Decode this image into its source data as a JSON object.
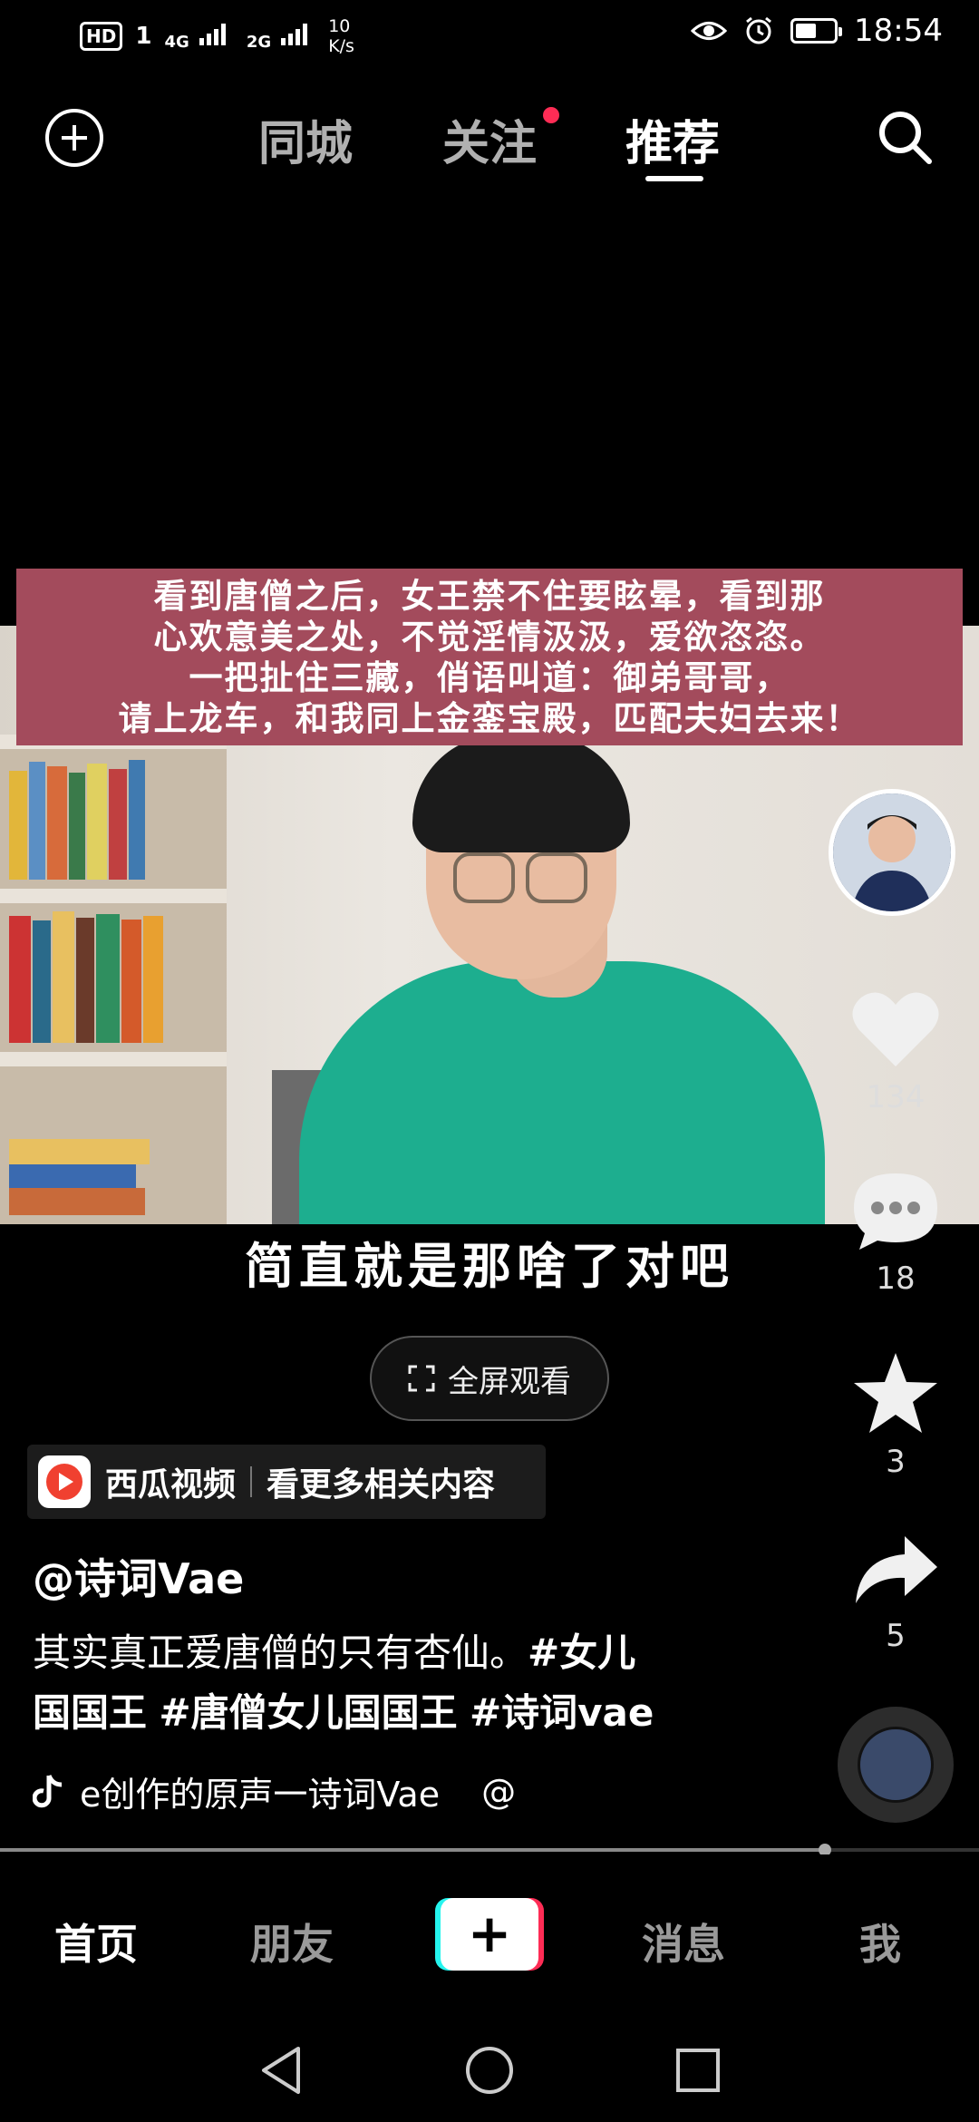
{
  "status_bar": {
    "hd": "HD",
    "sim1": "1",
    "network1": "4G",
    "network2": "2G",
    "speed_value": "10",
    "speed_unit": "K/s",
    "time": "18:54",
    "battery_level": 0.55
  },
  "top_nav": {
    "tabs": [
      {
        "label": "同城"
      },
      {
        "label": "关注"
      },
      {
        "label": "推荐"
      }
    ],
    "active_tab": "推荐"
  },
  "video": {
    "caption_lines": [
      "看到唐僧之后，女王禁不住要眩晕，看到那",
      "心欢意美之处，不觉淫情汲汲，爱欲恣恣。",
      "一把扯住三藏，俏语叫道：御弟哥哥，",
      "请上龙车，和我同上金銮宝殿，匹配夫妇去来！"
    ],
    "subtitle": "简直就是那啥了对吧",
    "fullscreen_label": "全屏观看",
    "progress": 0.843
  },
  "actions": {
    "likes": "134",
    "comments": "18",
    "favorites": "3",
    "shares": "5"
  },
  "xigua": {
    "app_name": "西瓜视频",
    "link_text": "看更多相关内容"
  },
  "post": {
    "author": "@诗词Vae",
    "desc_text": "其实真正爱唐僧的只有杏仙。",
    "tag1a": "#女儿",
    "tag1b": "国国王",
    "tag2": "#唐僧女儿国国王",
    "tag3": "#诗词vae",
    "music": "e创作的原声一诗词Vae",
    "music_tail": "@"
  },
  "bottom_nav": {
    "home": "首页",
    "friends": "朋友",
    "create": "+",
    "messages": "消息",
    "me": "我"
  },
  "colors": {
    "accent": "#fe2c55",
    "cyan": "#25f4ee",
    "caption_bg": "#a34b5c"
  }
}
